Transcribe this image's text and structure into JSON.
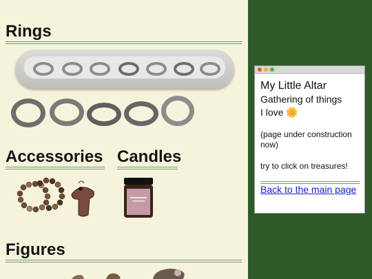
{
  "sections": {
    "rings": "Rings",
    "accessories": "Accessories",
    "candles": "Candles",
    "figures": "Figures"
  },
  "window": {
    "title": "My Little Altar",
    "subtitle_line1": "Gathering of things",
    "subtitle_line2": "I love 🌼",
    "note": "(page under construction now)",
    "hint": "try to click on treasures!",
    "link": "Back to the main page"
  },
  "colors": {
    "page_background": "#f5f3dc",
    "side_background": "#2e5a2a",
    "rule": "#6f9a6d",
    "link": "#1a1acc"
  },
  "icons": [
    "flower-emoji"
  ]
}
